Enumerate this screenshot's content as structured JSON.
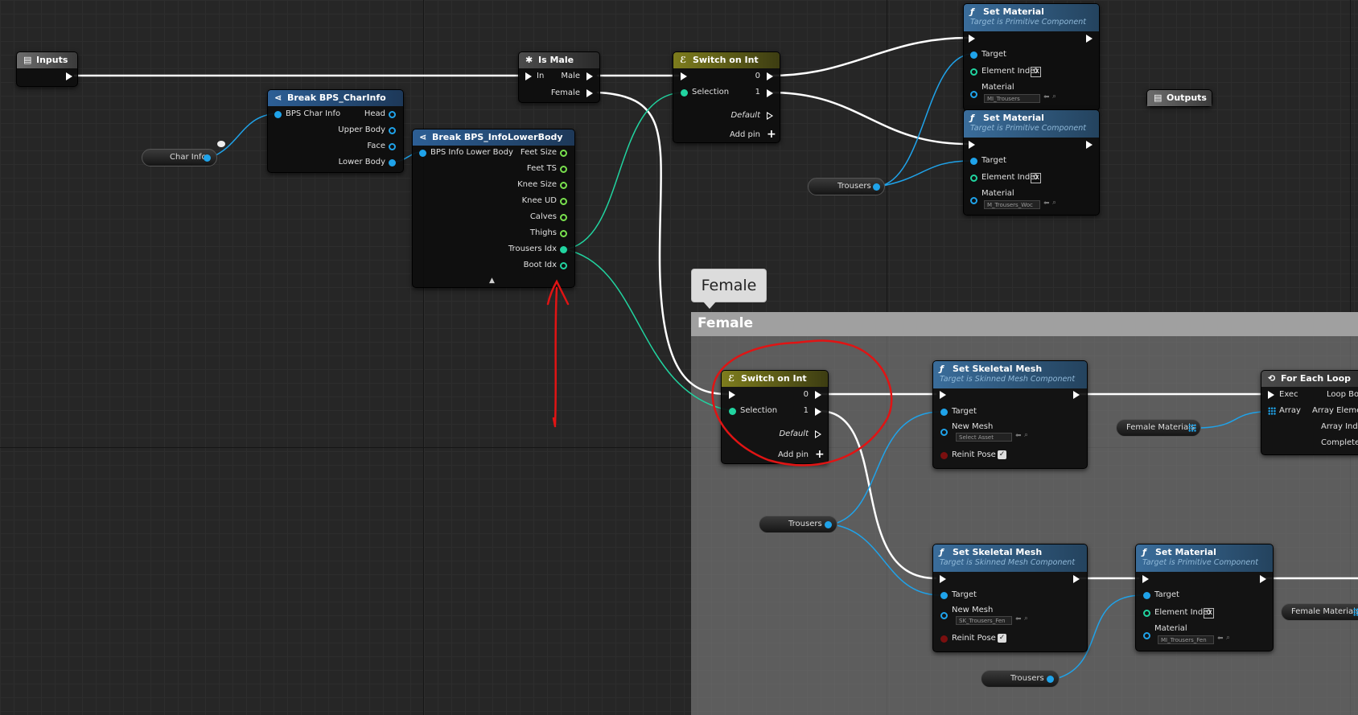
{
  "comment": {
    "title": "Female",
    "bubble": "Female"
  },
  "nodes": {
    "inputs": {
      "title": "Inputs"
    },
    "outputs": {
      "title": "Outputs"
    },
    "is_male": {
      "title": "Is Male",
      "in": "In",
      "male": "Male",
      "female": "Female"
    },
    "break_char": {
      "title": "Break BPS_CharInfo",
      "input": "BPS Char Info",
      "outputs": [
        "Head",
        "Upper Body",
        "Face",
        "Lower Body"
      ]
    },
    "break_lower": {
      "title": "Break BPS_InfoLowerBody",
      "input": "BPS Info Lower Body",
      "outputs": [
        "Feet Size",
        "Feet TS",
        "Knee Size",
        "Knee UD",
        "Calves",
        "Thighs",
        "Trousers Idx",
        "Boot Idx"
      ]
    },
    "switch_top": {
      "title": "Switch on Int",
      "selection": "Selection",
      "out0": "0",
      "out1": "1",
      "default": "Default",
      "add_pin": "Add pin"
    },
    "switch_female": {
      "title": "Switch on Int",
      "selection": "Selection",
      "out0": "0",
      "out1": "1",
      "default": "Default",
      "add_pin": "Add pin"
    },
    "set_material_1": {
      "title": "Set Material",
      "subtitle": "Target is Primitive Component",
      "target": "Target",
      "element_index": "Element Index",
      "index_value": "0",
      "material": "Material",
      "material_value": "MI_Trousers"
    },
    "set_material_2": {
      "title": "Set Material",
      "subtitle": "Target is Primitive Component",
      "target": "Target",
      "element_index": "Element Index",
      "index_value": "0",
      "material": "Material",
      "material_value": "M_Trousers_Woc"
    },
    "set_mesh_1": {
      "title": "Set Skeletal Mesh",
      "subtitle": "Target is Skinned Mesh Component",
      "target": "Target",
      "new_mesh": "New Mesh",
      "mesh_value": "Select Asset",
      "reinit": "Reinit Pose"
    },
    "set_mesh_2": {
      "title": "Set Skeletal Mesh",
      "subtitle": "Target is Skinned Mesh Component",
      "target": "Target",
      "new_mesh": "New Mesh",
      "mesh_value": "SK_Trousers_Fen",
      "reinit": "Reinit Pose"
    },
    "set_material_3": {
      "title": "Set Material",
      "subtitle": "Target is Primitive Component",
      "target": "Target",
      "element_index": "Element Index",
      "index_value": "0",
      "material": "Material",
      "material_value": "MI_Trousers_Fen"
    },
    "for_each": {
      "title": "For Each Loop",
      "exec": "Exec",
      "array": "Array",
      "loop_body": "Loop Body",
      "array_element": "Array Element",
      "array_index": "Array Index",
      "completed": "Completed"
    }
  },
  "variables": {
    "char_info": "Char Info",
    "trousers": "Trousers",
    "female_materials": "Female Materials"
  },
  "glyphs": {
    "check": "✓",
    "plus": "+",
    "collapse": "▲",
    "dropdown": "▾",
    "arrow": "⬅",
    "magnifier": "⌕"
  },
  "colors": {
    "exec_wire": "#ffffff",
    "object_wire": "#1fa3ea",
    "struct_wire": "#21d4a0",
    "annotation": "#e01414",
    "comment_header": "#a0a0a0"
  }
}
